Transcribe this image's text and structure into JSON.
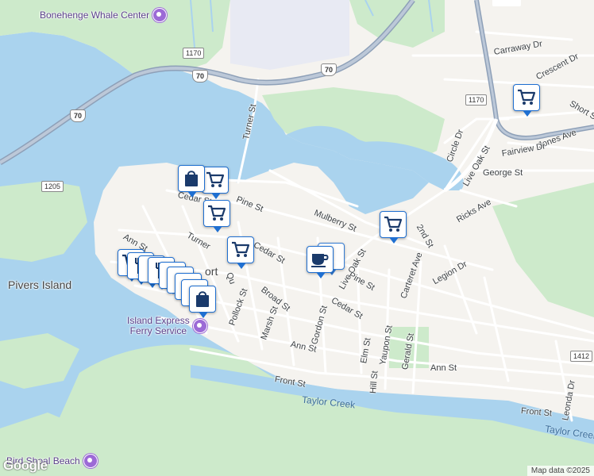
{
  "map": {
    "attribution": "Map data ©2025",
    "logo": "Google"
  },
  "colors": {
    "water": "#aad3ee",
    "land": "#f5f3ef",
    "green": "#cdeacb",
    "road": "#ffffff",
    "highway": "#8ea0b8",
    "marker_border": "#1f6fd1",
    "poi": "#9c6ad6"
  },
  "pois": {
    "whale": "Bonehenge Whale Center",
    "ferry": "Island Express\nFerry Service",
    "beach": "Bird Shoal Beach"
  },
  "places": {
    "pivers": "Pivers Island",
    "fort": "ort",
    "creek": "Taylor Creek",
    "creek2": "Taylor Creek"
  },
  "shields": {
    "r1170a": "1170",
    "r70a": "70",
    "r70b": "70",
    "r70c": "70",
    "r1170b": "1170",
    "r1205": "1205",
    "r1412": "1412"
  },
  "streets": {
    "turner1": "Turner St",
    "carraway": "Carraway Dr",
    "crescent": "Crescent Dr",
    "short": "Short S",
    "jones": "Jones Ave",
    "fairview": "Fairview Dr",
    "circle": "Circle Dr",
    "liveoak1": "Live Oak St",
    "george": "George St",
    "cedar1": "Cedar St",
    "pine1": "Pine St",
    "mulberry": "Mulberry St",
    "ricks": "Ricks Ave",
    "second": "2nd St",
    "ann1": "Ann St",
    "turner2": "Turner",
    "cedar2": "Cedar St",
    "liveoak2": "Live Oak St",
    "legion": "Legion Dr",
    "carteret": "Carteret Ave",
    "pine2": "Pine St",
    "qu": "Qu",
    "broad": "Broad St",
    "pollock": "Pollock St",
    "marsh": "Marsh St",
    "cedar3": "Cedar St",
    "gordon": "Gordon St",
    "elm": "Elm St",
    "yaupon": "Yaupon St",
    "gerald": "Gerald St",
    "ann2": "Ann St",
    "ann3": "Ann St",
    "hill": "Hill St",
    "front1": "Front St",
    "front2": "Front St",
    "leonda": "Leonda Dr"
  },
  "markers": [
    {
      "icon": "cart-icon"
    },
    {
      "icon": "cart-icon"
    },
    {
      "icon": "shopping-bag-icon"
    },
    {
      "icon": "cart-icon"
    },
    {
      "icon": "cart-icon"
    },
    {
      "icon": "cart-icon"
    },
    {
      "icon": "coffee-icon"
    },
    {
      "icon": "cart-icon"
    },
    {
      "icon": "restaurant-icon"
    },
    {
      "icon": "restaurant-icon"
    },
    {
      "icon": "shopping-bag-icon"
    }
  ]
}
